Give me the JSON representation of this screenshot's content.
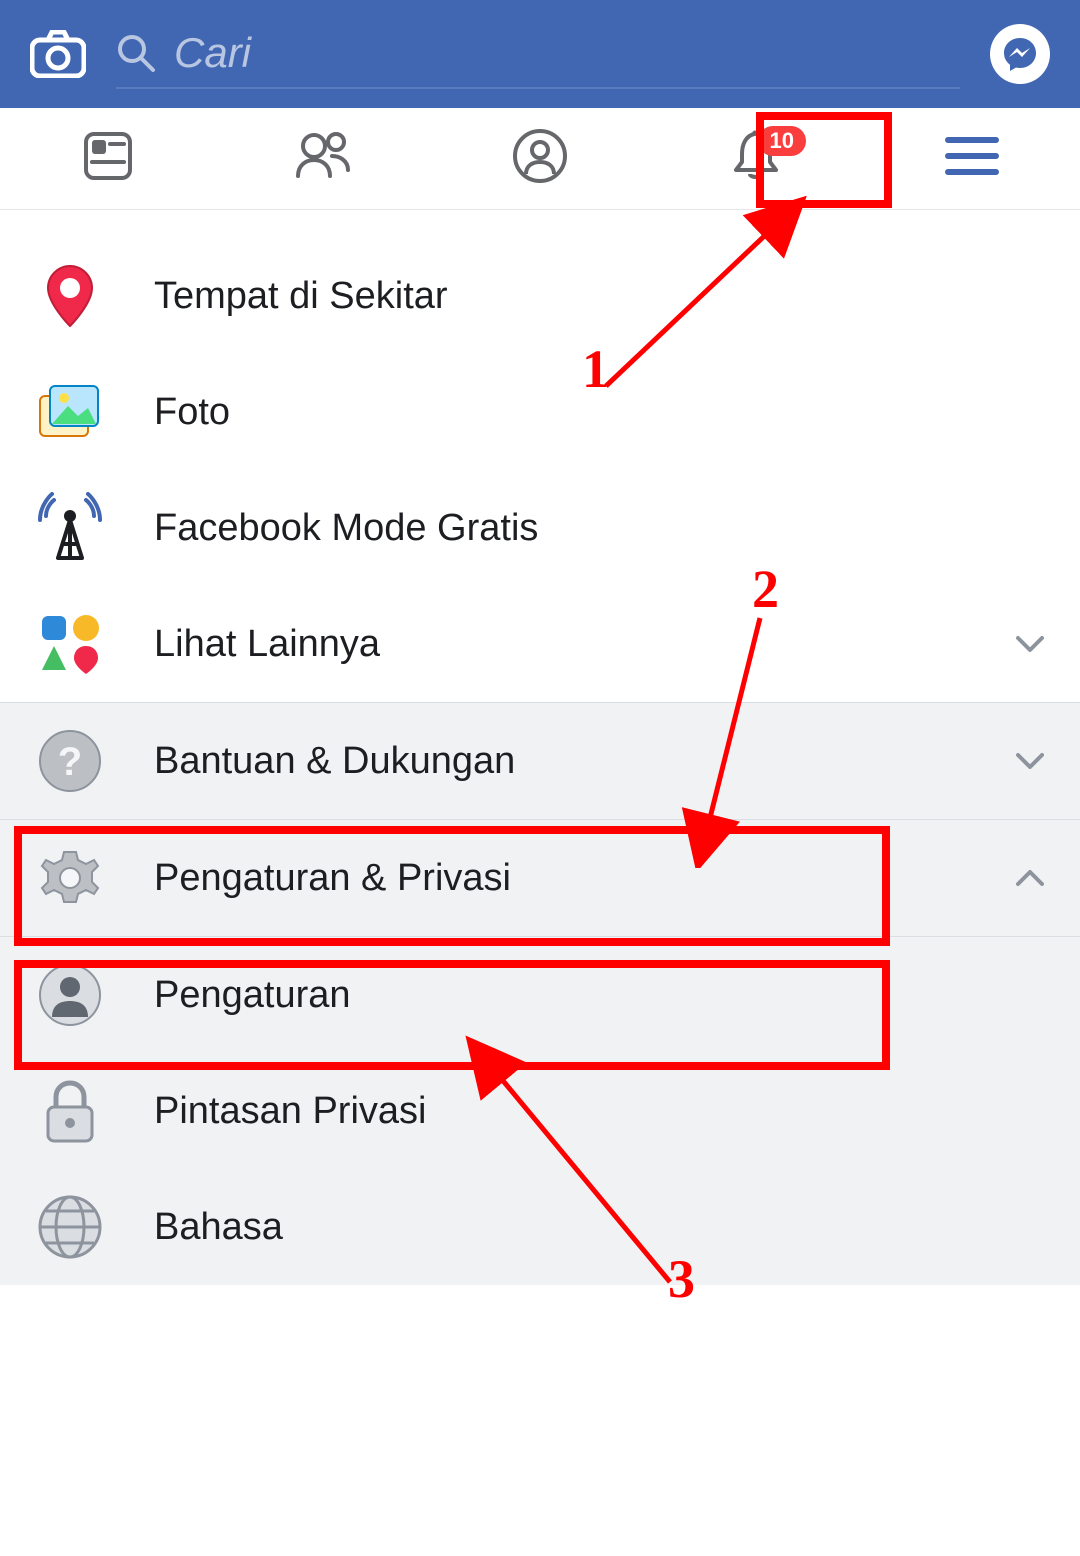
{
  "header": {
    "search_placeholder": "Cari"
  },
  "tabs": {
    "notification_badge": "10"
  },
  "menu": {
    "nearby_places": "Tempat di Sekitar",
    "photos": "Foto",
    "free_mode": "Facebook Mode Gratis",
    "see_more": "Lihat Lainnya",
    "help_support": "Bantuan & Dukungan",
    "settings_privacy": "Pengaturan & Privasi",
    "settings": "Pengaturan",
    "privacy_shortcuts": "Pintasan Privasi",
    "language": "Bahasa"
  },
  "annotations": {
    "n1": "1",
    "n2": "2",
    "n3": "3"
  }
}
